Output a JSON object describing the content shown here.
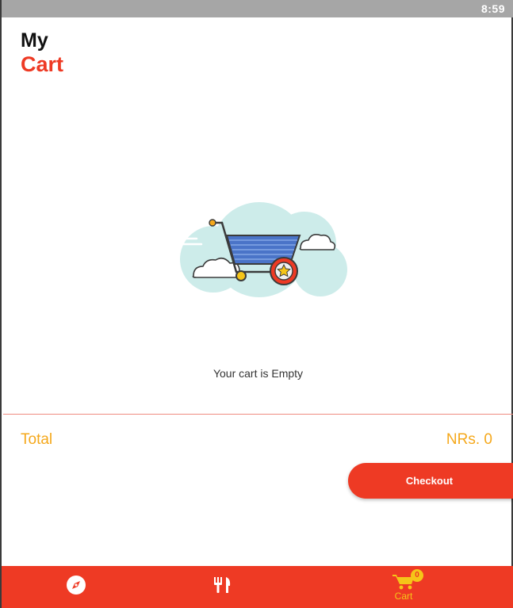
{
  "status_bar": {
    "time": "8:59"
  },
  "header": {
    "title_line1": "My",
    "title_line2": "Cart"
  },
  "empty_state": {
    "message": "Your cart is Empty",
    "illustration": "shopping-cart-with-clouds"
  },
  "summary": {
    "total_label": "Total",
    "total_value": "NRs. 0"
  },
  "actions": {
    "checkout_label": "Checkout"
  },
  "bottom_nav": {
    "items": [
      {
        "icon": "compass-icon",
        "label": ""
      },
      {
        "icon": "fork-knife-icon",
        "label": ""
      },
      {
        "icon": "cart-icon",
        "label": "Cart",
        "badge": "0"
      }
    ]
  },
  "colors": {
    "accent": "#ee3a24",
    "total_text": "#f5a81b",
    "active_nav": "#f5c518",
    "status_bar": "#a6a6a6",
    "illustration_cloud": "#cdecea",
    "cart_basket": "#4a74c8"
  }
}
